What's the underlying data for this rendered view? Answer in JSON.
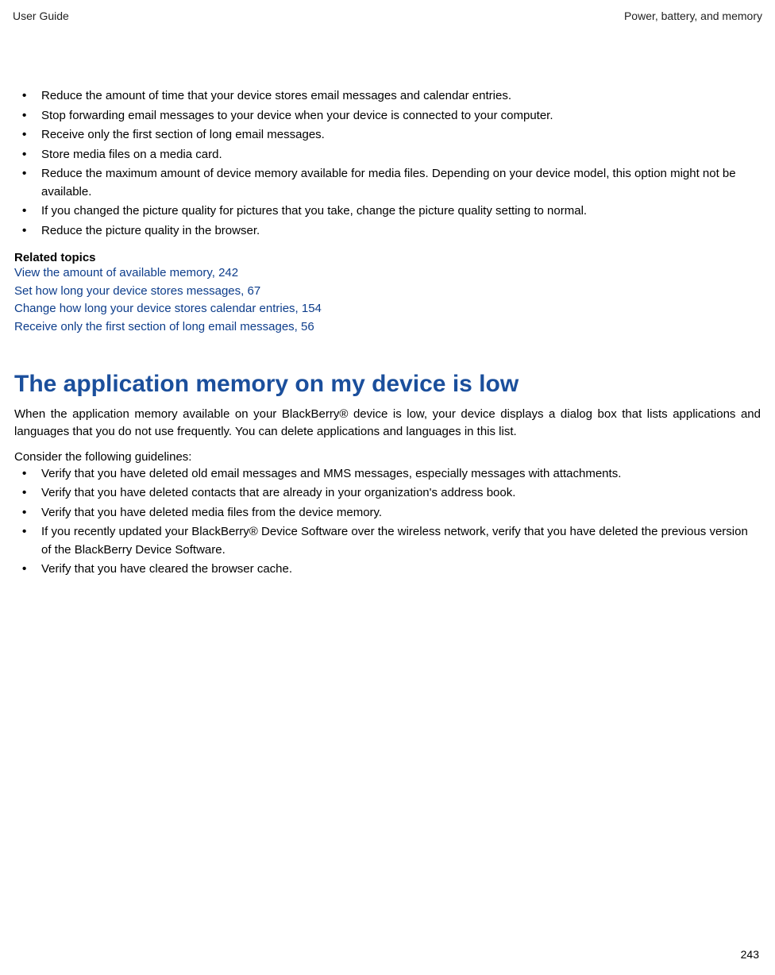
{
  "header": {
    "left": "User Guide",
    "right": "Power, battery, and memory"
  },
  "tips": [
    "Reduce the amount of time that your device stores email messages and calendar entries.",
    "Stop forwarding email messages to your device when your device is connected to your computer.",
    "Receive only the first section of long email messages.",
    "Store media files on a media card.",
    "Reduce the maximum amount of device memory available for media files. Depending on your device model, this option might not be available.",
    "If you changed the picture quality for pictures that you take, change the picture quality setting to normal.",
    "Reduce the picture quality in the browser."
  ],
  "related": {
    "heading": "Related topics",
    "links": [
      "View the amount of available memory, 242",
      "Set how long your device stores messages, 67",
      "Change how long your device stores calendar entries, 154",
      "Receive only the first section of long email messages, 56"
    ]
  },
  "section": {
    "title": "The application memory on my device is low",
    "paragraph": "When the application memory available on your BlackBerry® device is low, your device displays a dialog box that lists applications and languages that you do not use frequently. You can delete applications and languages in this list.",
    "consider": "Consider the following guidelines:",
    "guidelines": [
      "Verify that you have deleted old email messages and MMS messages, especially messages with attachments.",
      "Verify that you have deleted contacts that are already in your organization's address book.",
      "Verify that you have deleted media files from the device memory.",
      "If you recently updated your BlackBerry® Device Software over the wireless network, verify that you have deleted the previous version of the BlackBerry Device Software.",
      "Verify that you have cleared the browser cache."
    ]
  },
  "pageNumber": "243"
}
